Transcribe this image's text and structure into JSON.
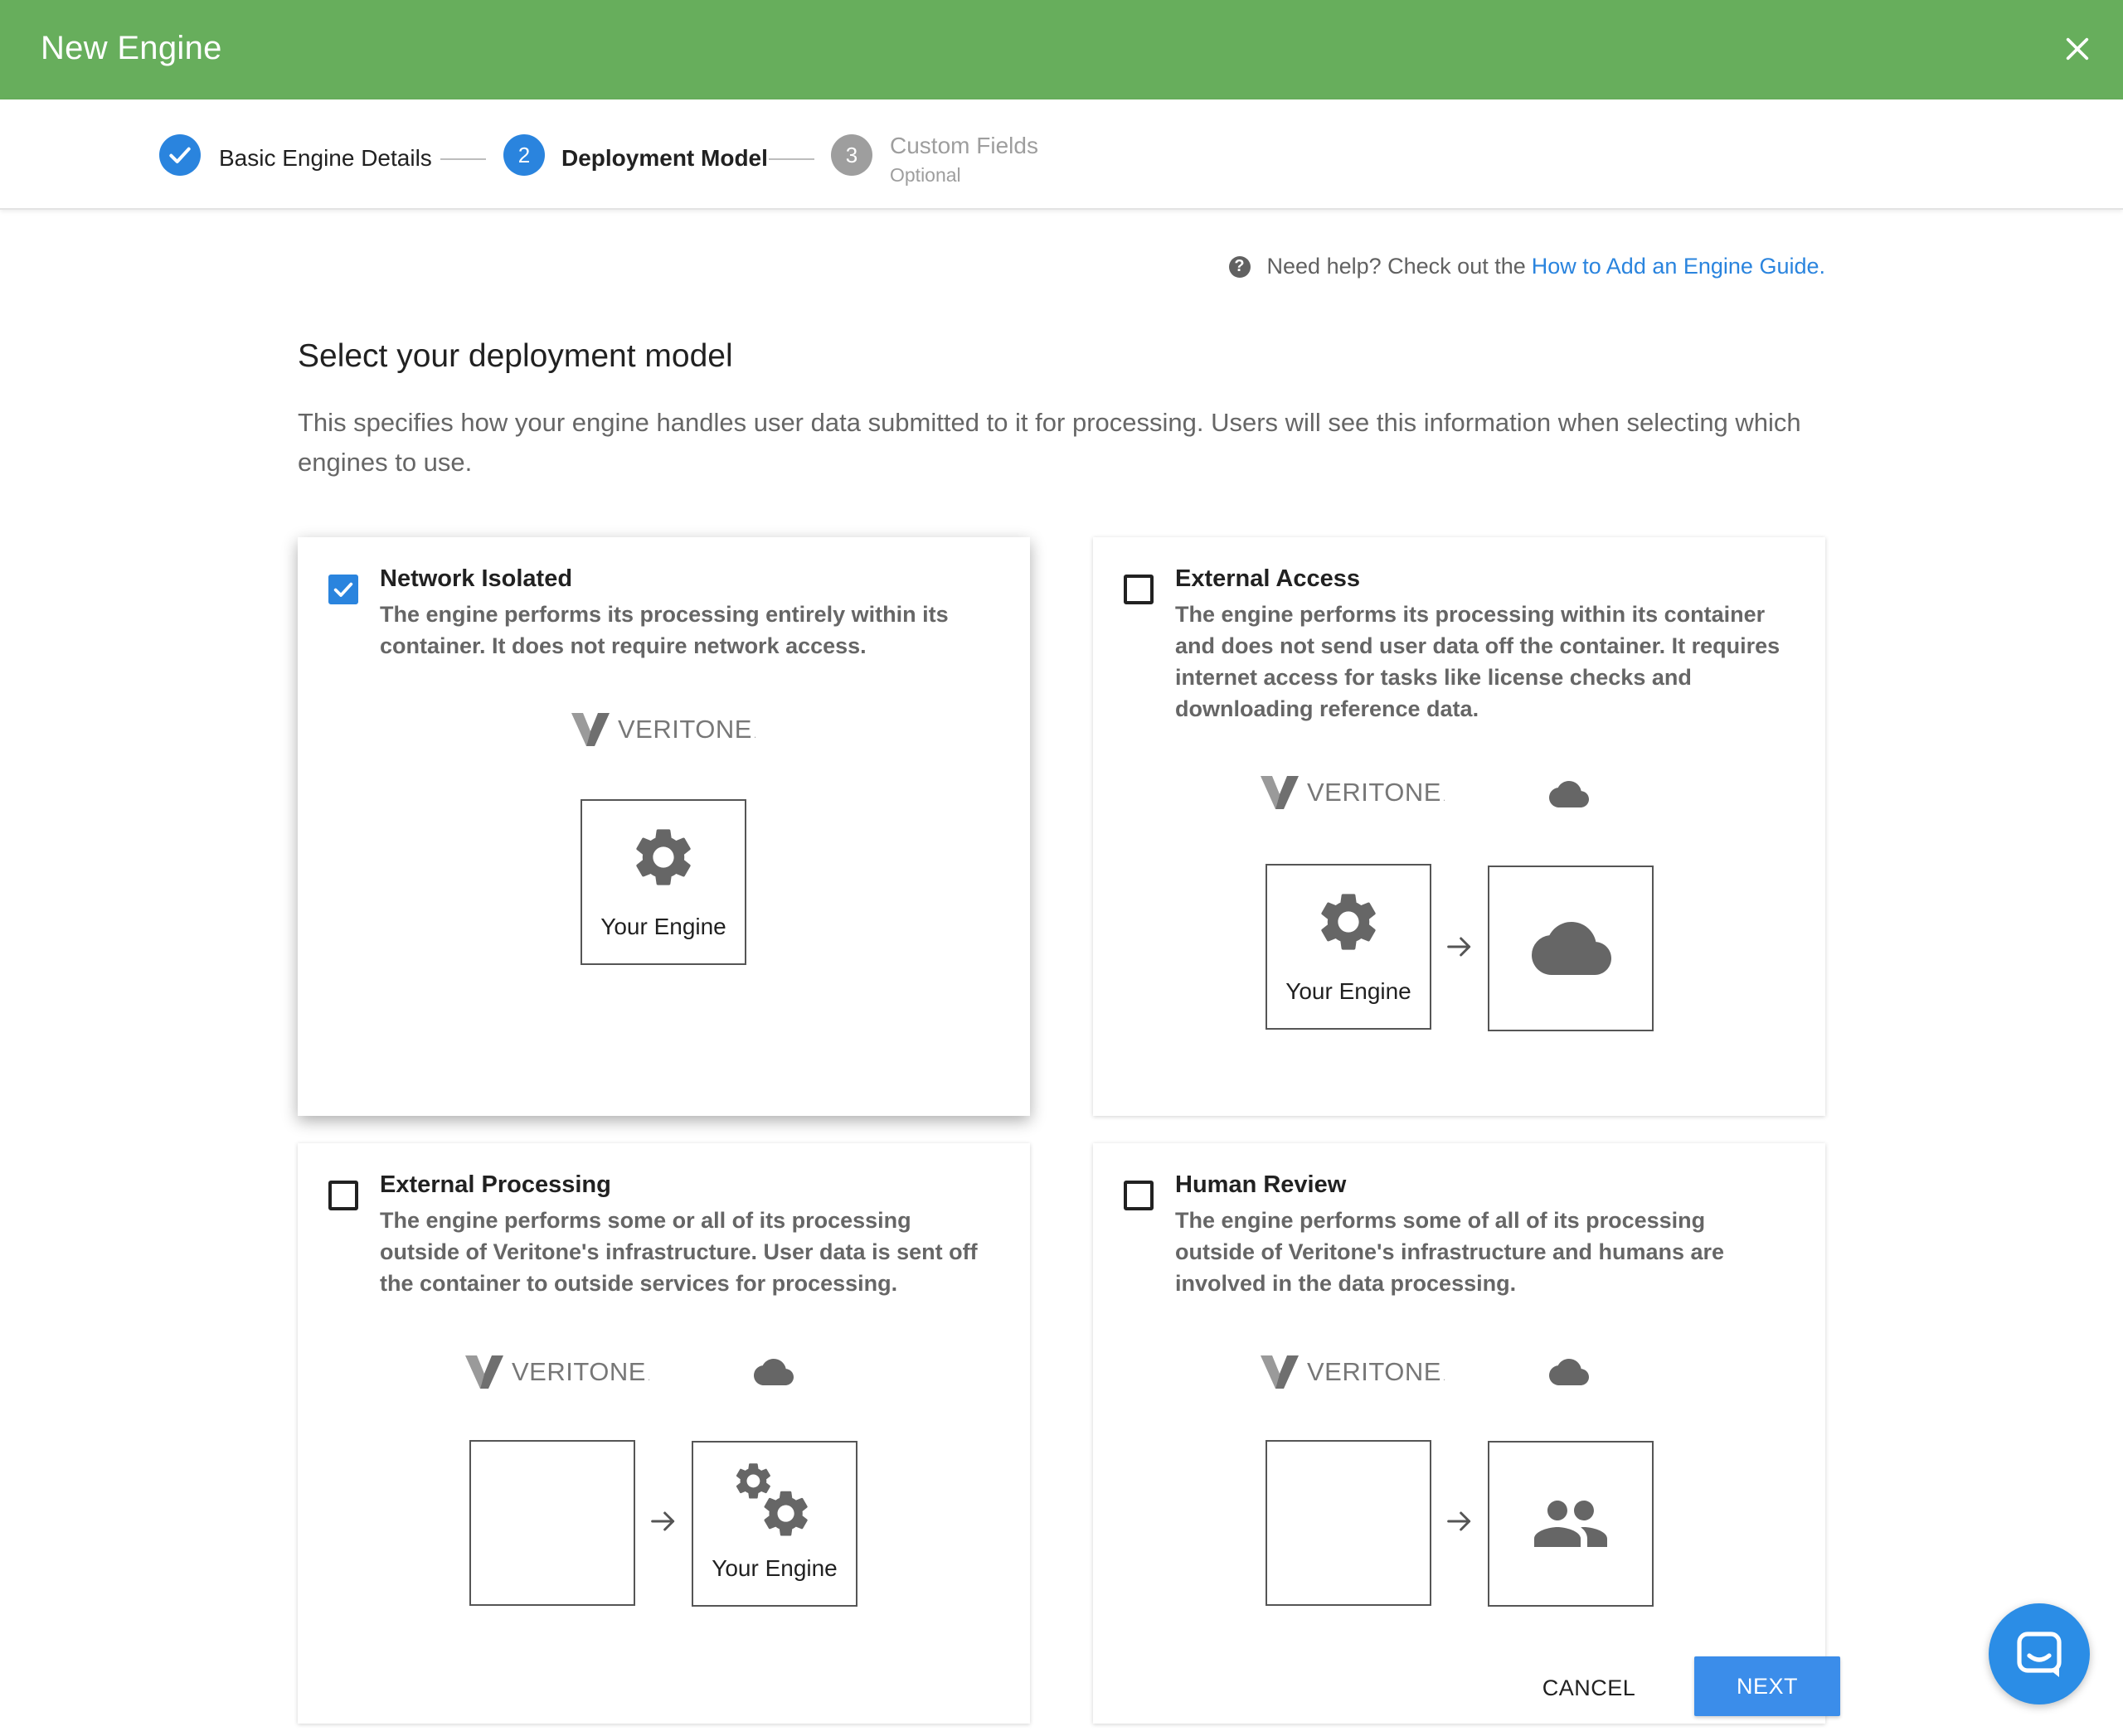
{
  "header": {
    "title": "New Engine"
  },
  "stepper": {
    "steps": [
      {
        "number": "",
        "label": "Basic Engine Details",
        "status": "completed"
      },
      {
        "number": "2",
        "label": "Deployment Model",
        "status": "active"
      },
      {
        "number": "3",
        "label": "Custom Fields",
        "sublabel": "Optional",
        "status": "inactive"
      }
    ]
  },
  "help": {
    "text": "Need help? Check out the",
    "link": "How to Add an Engine Guide."
  },
  "section": {
    "title": "Select your deployment model",
    "description": "This specifies how your engine handles user data submitted to it for processing. Users will see this information when selecting which engines to use."
  },
  "cards": [
    {
      "title": "Network Isolated",
      "checked": true,
      "description": "The engine performs its processing entirely within its container. It does not require network access.",
      "logo": "VERITONE",
      "box_label": "Your Engine"
    },
    {
      "title": "External Access",
      "checked": false,
      "description": "The engine performs its processing within its container and does not send user data off the container. It requires internet access for tasks like license checks and downloading reference data.",
      "logo": "VERITONE",
      "box_label": "Your Engine"
    },
    {
      "title": "External Processing",
      "checked": false,
      "description": "The engine performs some or all of its processing outside of Veritone's infrastructure. User data is sent off the container to outside services for processing.",
      "logo": "VERITONE",
      "box_label": "Your Engine"
    },
    {
      "title": "Human Review",
      "checked": false,
      "description": "The engine performs some of all of its processing outside of Veritone's infrastructure and humans are involved in the data processing.",
      "logo": "VERITONE"
    }
  ],
  "actions": {
    "cancel": "CANCEL",
    "next": "NEXT"
  },
  "colors": {
    "header": "#67ae5c",
    "accent": "#2a84de",
    "primary_button": "#3b8dea",
    "inactive_step": "#9e9e9e"
  },
  "icons": [
    "close-icon",
    "check-icon",
    "help-icon",
    "gear-icon",
    "gears-icon",
    "cloud-icon",
    "people-icon",
    "arrow-right-icon",
    "chat-icon"
  ]
}
